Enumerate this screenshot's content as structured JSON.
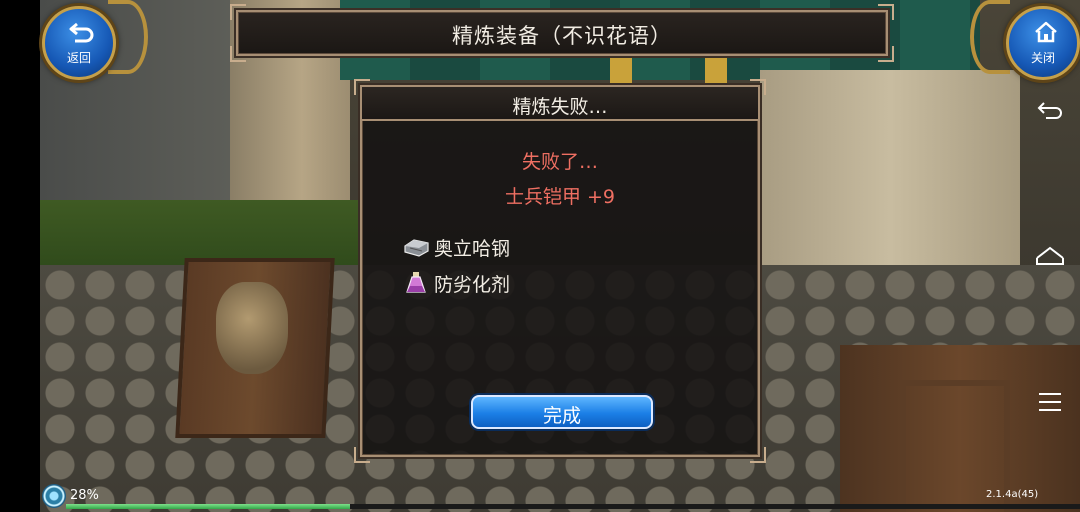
{
  "header": {
    "title": "精炼装备（不识花语）"
  },
  "buttons": {
    "back_label": "返回",
    "close_label": "关闭",
    "done_label": "完成"
  },
  "dialog": {
    "title": "精炼失败…",
    "fail_message": "失败了…",
    "item_name": "士兵铠甲 +9",
    "materials": [
      {
        "icon": "steel-ingot-icon",
        "name": "奥立哈钢"
      },
      {
        "icon": "potion-bottle-icon",
        "name": "防劣化剂"
      }
    ]
  },
  "status": {
    "progress_text": "28%",
    "progress_value": 0.28,
    "version": "2.1.4a(45)"
  },
  "nav_icons": [
    "back-icon",
    "home-icon",
    "menu-icon"
  ],
  "colors": {
    "fail_text": "#ef6f62",
    "button_blue": "#1b7fe6",
    "frame_gold": "#a88f74"
  }
}
